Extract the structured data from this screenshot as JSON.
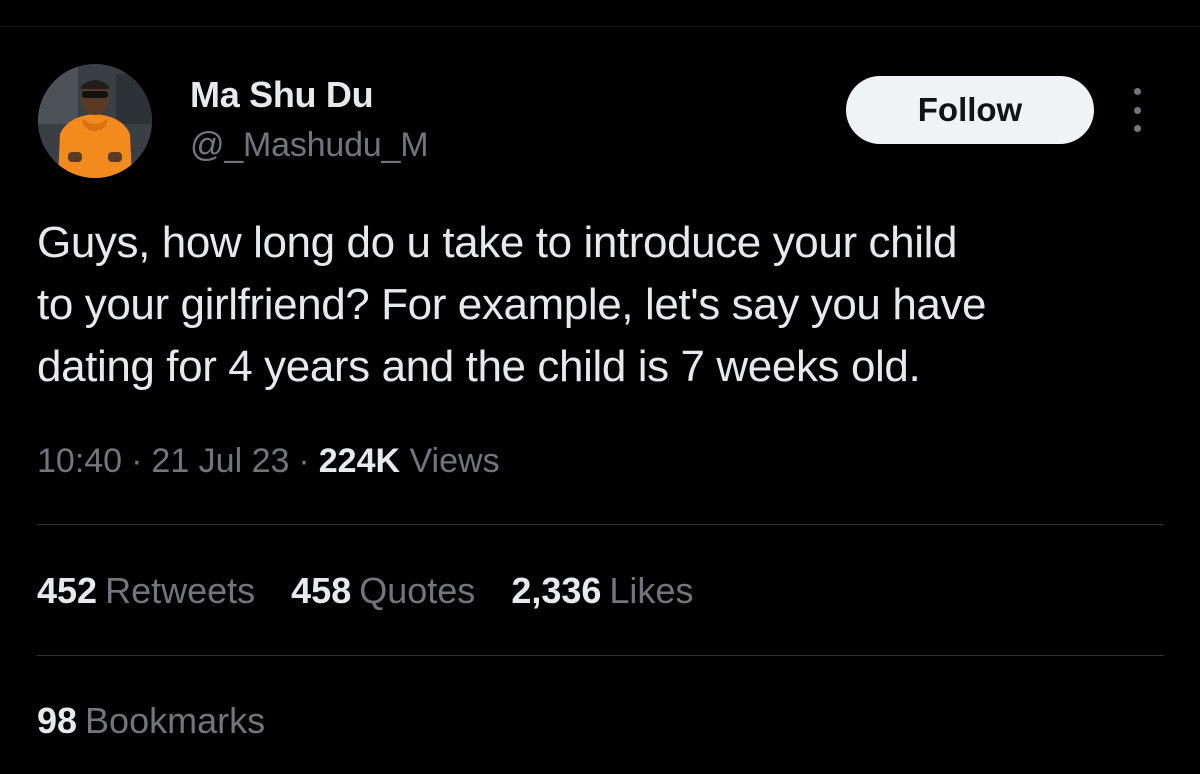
{
  "author": {
    "name": "Ma Shu Du",
    "handle": "@_Mashudu_M",
    "avatar_icon": "profile-photo-person-orange-hoodie"
  },
  "actions": {
    "follow_label": "Follow",
    "more_icon": "more-vertical-icon"
  },
  "tweet": {
    "lines": [
      "Guys, how long do u take to introduce your child",
      "to your girlfriend? For example, let's say you have",
      "dating for 4 years and the child is 7 weeks old."
    ]
  },
  "meta": {
    "time": "10:40",
    "date": "21 Jul 23",
    "separator": "·",
    "views_count": "224K",
    "views_label": "Views"
  },
  "stats": {
    "retweets": {
      "count": "452",
      "label": "Retweets"
    },
    "quotes": {
      "count": "458",
      "label": "Quotes"
    },
    "likes": {
      "count": "2,336",
      "label": "Likes"
    },
    "bookmarks": {
      "count": "98",
      "label": "Bookmarks"
    }
  },
  "colors": {
    "background": "#000000",
    "primary_text": "#e7e9ea",
    "secondary_text": "#71767b",
    "divider": "#2f3336",
    "follow_button_bg": "#eff3f4",
    "avatar_hoodie": "#f28a1e"
  }
}
